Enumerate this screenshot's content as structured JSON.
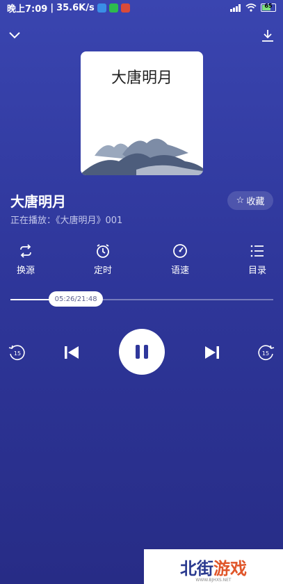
{
  "status_bar": {
    "time": "晚上7:09",
    "speed": "35.6K/s",
    "battery": "65"
  },
  "cover": {
    "title": "大唐明月"
  },
  "track": {
    "title": "大唐明月",
    "now_playing": "正在播放：《大唐明月》001",
    "favorite_label": "收藏"
  },
  "actions": [
    {
      "label": "换源",
      "icon": "switch-source-icon"
    },
    {
      "label": "定时",
      "icon": "timer-icon"
    },
    {
      "label": "语速",
      "icon": "speed-icon"
    },
    {
      "label": "目录",
      "icon": "list-icon"
    }
  ],
  "progress": {
    "time_display": "05:26/21:48",
    "fraction": 0.249
  },
  "controls": {
    "rewind_seconds": "15",
    "forward_seconds": "15"
  },
  "watermark": {
    "brand_part1": "北街",
    "brand_part2": "游戏",
    "url": "WWW.BJHXS.NET"
  },
  "colors": {
    "bg_top": "#3a45b0",
    "bg_bottom": "#272c86",
    "accent_white": "#ffffff"
  }
}
